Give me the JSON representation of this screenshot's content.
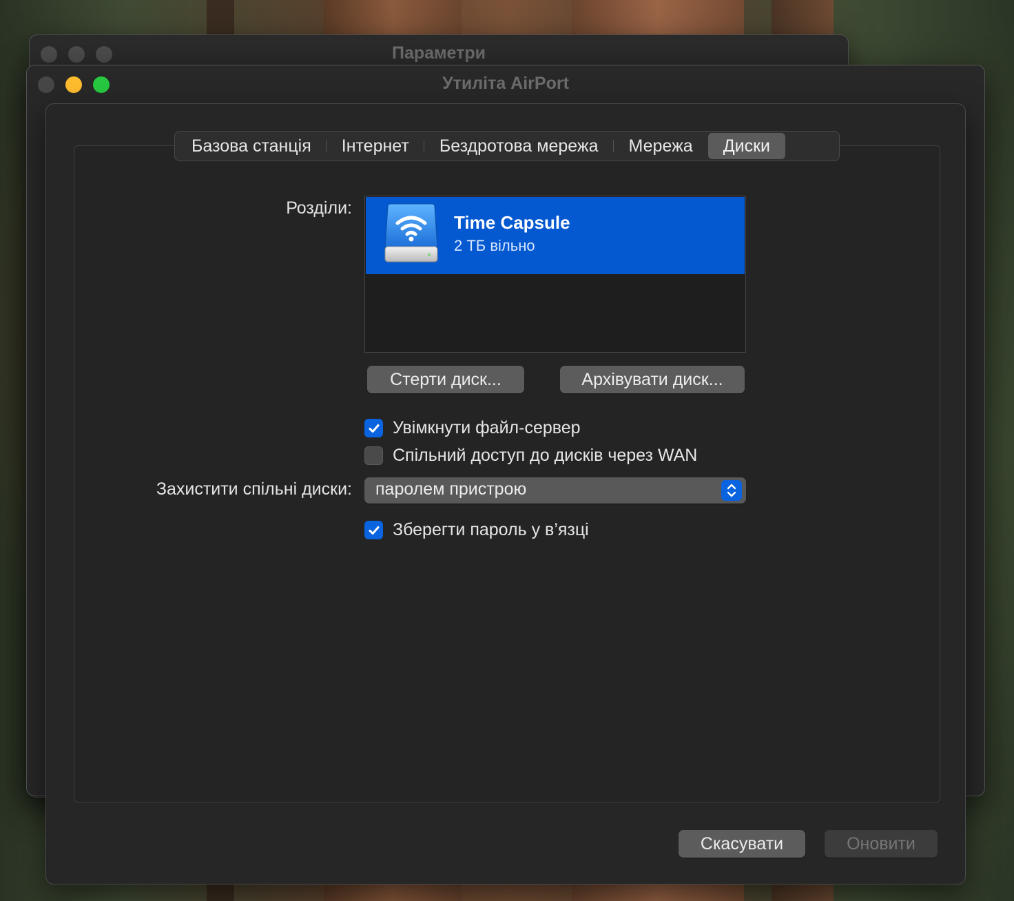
{
  "background_window": {
    "title": "Параметри"
  },
  "window": {
    "title": "Утиліта AirPort"
  },
  "tabs": [
    {
      "label": "Базова станція",
      "active": false
    },
    {
      "label": "Інтернет",
      "active": false
    },
    {
      "label": "Бездротова мережа",
      "active": false
    },
    {
      "label": "Мережа",
      "active": false
    },
    {
      "label": "Диски",
      "active": true
    }
  ],
  "disks": {
    "partitions_label": "Розділи:",
    "partitions": [
      {
        "name": "Time Capsule",
        "free": "2 ТБ вільно",
        "selected": true,
        "icon": "wifi-disk-icon"
      }
    ],
    "erase_button": "Стерти диск...",
    "archive_button": "Архівувати диск...",
    "file_server_checkbox": {
      "label": "Увімкнути файл-сервер",
      "checked": true
    },
    "wan_sharing_checkbox": {
      "label": "Спільний доступ до дисків через WAN",
      "checked": false
    },
    "secure_label": "Захистити спільні диски:",
    "secure_value": "паролем пристрою",
    "keychain_checkbox": {
      "label": "Зберегти пароль у в’язці",
      "checked": true
    }
  },
  "footer": {
    "cancel_button": "Скасувати",
    "update_button": "Оновити",
    "update_enabled": false
  },
  "colors": {
    "accent": "#0a64e0",
    "selection": "#0458d0",
    "close": "#4d4d4d",
    "minimize": "#febc2e",
    "zoom": "#28c840"
  }
}
